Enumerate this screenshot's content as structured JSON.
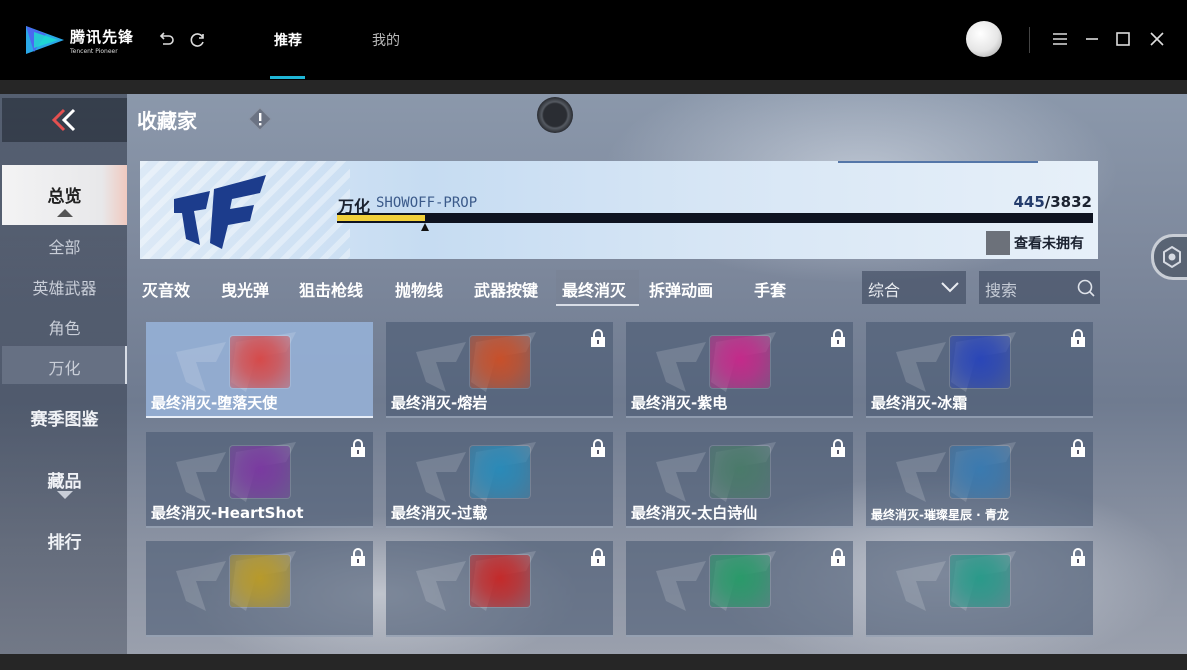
{
  "titlebar": {
    "brand_cn": "腾讯先锋",
    "brand_en": "Tencent Pioneer",
    "tabs": [
      {
        "label": "推荐",
        "active": true
      },
      {
        "label": "我的",
        "active": false
      }
    ],
    "accent": "#1fb6d6"
  },
  "game": {
    "page_title": "收藏家",
    "sidebar": {
      "items": [
        {
          "label": "总览",
          "selected": true
        },
        {
          "label": "全部"
        },
        {
          "label": "英雄武器"
        },
        {
          "label": "角色"
        },
        {
          "label": "万化",
          "selected": true
        },
        {
          "label": "赛季图鉴"
        },
        {
          "label": "藏品"
        },
        {
          "label": "排行"
        }
      ]
    },
    "banner": {
      "name": "万化",
      "subtitle": "SHOWOFF-PROP",
      "owned": "445",
      "total": "/3832",
      "progress": 0.116,
      "check_label": "查看未拥有"
    },
    "categories": [
      {
        "label": "灭音效"
      },
      {
        "label": "曳光弹"
      },
      {
        "label": "狙击枪线"
      },
      {
        "label": "抛物线"
      },
      {
        "label": "武器按键"
      },
      {
        "label": "最终消灭",
        "active": true
      },
      {
        "label": "拆弹动画"
      },
      {
        "label": "手套"
      }
    ],
    "sort": {
      "value": "综合"
    },
    "search": {
      "placeholder": "搜索"
    },
    "items": [
      {
        "label": "最终消灭-堕落天使",
        "locked": false,
        "color": "#d64a4a"
      },
      {
        "label": "最终消灭-熔岩",
        "locked": true,
        "color": "#c8502a"
      },
      {
        "label": "最终消灭-紫电",
        "locked": true,
        "color": "#c42a8a"
      },
      {
        "label": "最终消灭-冰霜",
        "locked": true,
        "color": "#2a46b8"
      },
      {
        "label": "最终消灭-HeartShot",
        "locked": true,
        "color": "#7a3aa0"
      },
      {
        "label": "最终消灭-过载",
        "locked": true,
        "color": "#2a8ab8"
      },
      {
        "label": "最终消灭-太白诗仙",
        "locked": true,
        "color": "#4a7a6a"
      },
      {
        "label": "最终消灭-璀璨星辰 · 青龙",
        "locked": true,
        "color": "#3a7ab0",
        "small": true
      },
      {
        "label": "",
        "locked": true,
        "color": "#b89a2a"
      },
      {
        "label": "",
        "locked": true,
        "color": "#c42a2a"
      },
      {
        "label": "",
        "locked": true,
        "color": "#2a9a6a"
      },
      {
        "label": "",
        "locked": true,
        "color": "#2a9a8a"
      }
    ]
  }
}
